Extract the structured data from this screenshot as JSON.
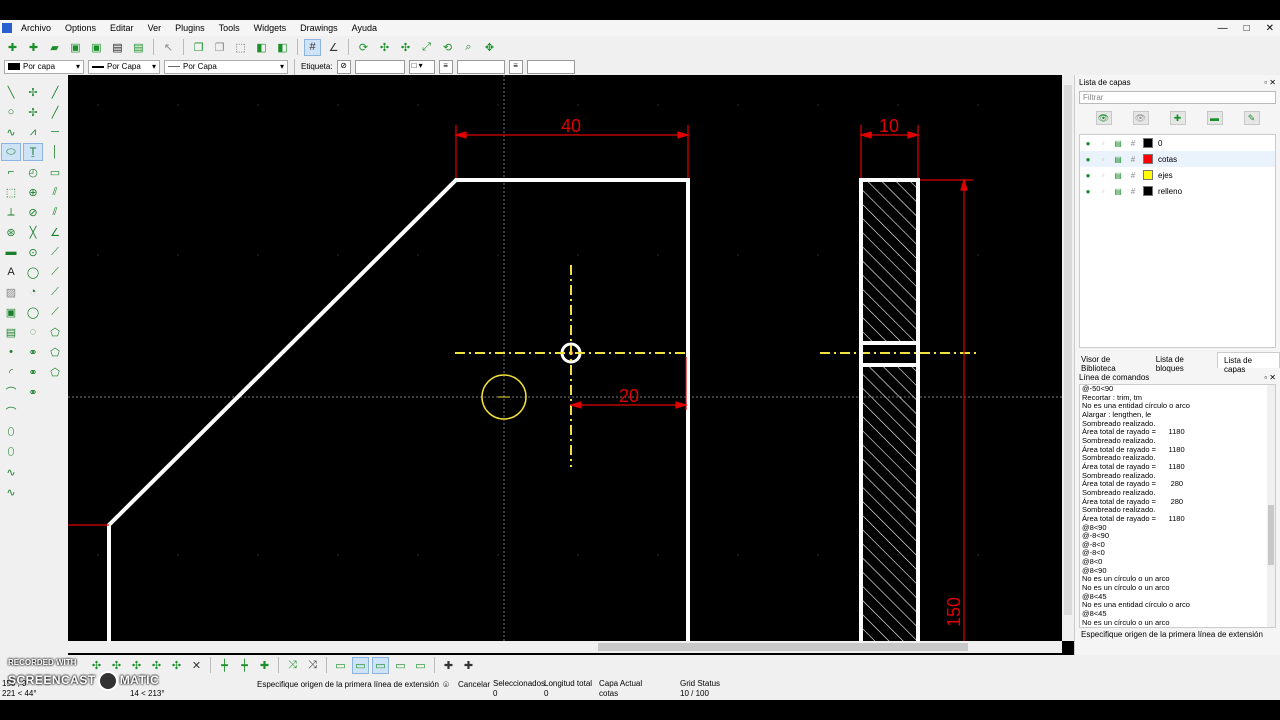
{
  "menu": [
    "Archivo",
    "Options",
    "Editar",
    "Ver",
    "Plugins",
    "Tools",
    "Widgets",
    "Drawings",
    "Ayuda"
  ],
  "window_controls": [
    "—",
    "□",
    "✕"
  ],
  "toolbar2": {
    "color": "Por capa",
    "linewidth": "Por Capa",
    "linetype": "Por Capa",
    "label": "Etiqueta:"
  },
  "drawing": {
    "dimensions": [
      "40",
      "10",
      "20",
      "150"
    ],
    "colors": {
      "background": "#000000",
      "geometry": "#ffffff",
      "dimension": "#e00000",
      "axis": "#f0e040",
      "crosshair": "#f0e040"
    }
  },
  "layers_panel": {
    "title": "Lista de capas",
    "filter_placeholder": "Filtrar",
    "layers": [
      {
        "name": "0",
        "color": "#000000"
      },
      {
        "name": "cotas",
        "color": "#ff0000"
      },
      {
        "name": "ejes",
        "color": "#ffff00"
      },
      {
        "name": "relleno",
        "color": "#000000"
      }
    ],
    "tabs": [
      "Visor de Biblioteca",
      "Lista de bloques",
      "Lista de capas"
    ]
  },
  "command_panel": {
    "title": "Línea de comandos",
    "log": [
      "@-50<90",
      "Recortar : trim, tm",
      "No es una entidad círculo o arco",
      "Alargar : lengthen, le",
      "Sombreado realizado.",
      "Área total de rayado =      1180",
      "Sombreado realizado.",
      "Área total de rayado =      1180",
      "Sombreado realizado.",
      "Área total de rayado =      1180",
      "Sombreado realizado.",
      "Área total de rayado =       280",
      "Sombreado realizado.",
      "Área total de rayado =       280",
      "Sombreado realizado.",
      "Área total de rayado =      1180",
      "@8<90",
      "@-8<90",
      "@-8<0",
      "@-8<0",
      "@8<0",
      "@8<90",
      "No es un círculo o un arco",
      "No es un círculo o un arco",
      "@8<45",
      "No es una entidad círculo o arco",
      "@8<45",
      "No es un círculo o un arco"
    ],
    "prompt": "Especifique origen de la primera línea de extensión"
  },
  "status_bar": {
    "coord_abs": "150 , 0",
    "coord_polar": "221 < 44°",
    "coord_rel": "14 < 213°",
    "prompt": "Especifique origen de la primera línea de extensión",
    "cancel": "Cancelar",
    "selected_label": "Seleccionados",
    "selected_value": "0",
    "length_label": "Longitud total",
    "length_value": "0",
    "layer_label": "Capa Actual",
    "layer_value": "cotas",
    "grid_label": "Grid Status",
    "grid_value": "10 / 100"
  },
  "watermark": {
    "recorded": "RECORDED WITH",
    "brand_a": "SCREENCAST",
    "brand_b": "MATIC"
  }
}
